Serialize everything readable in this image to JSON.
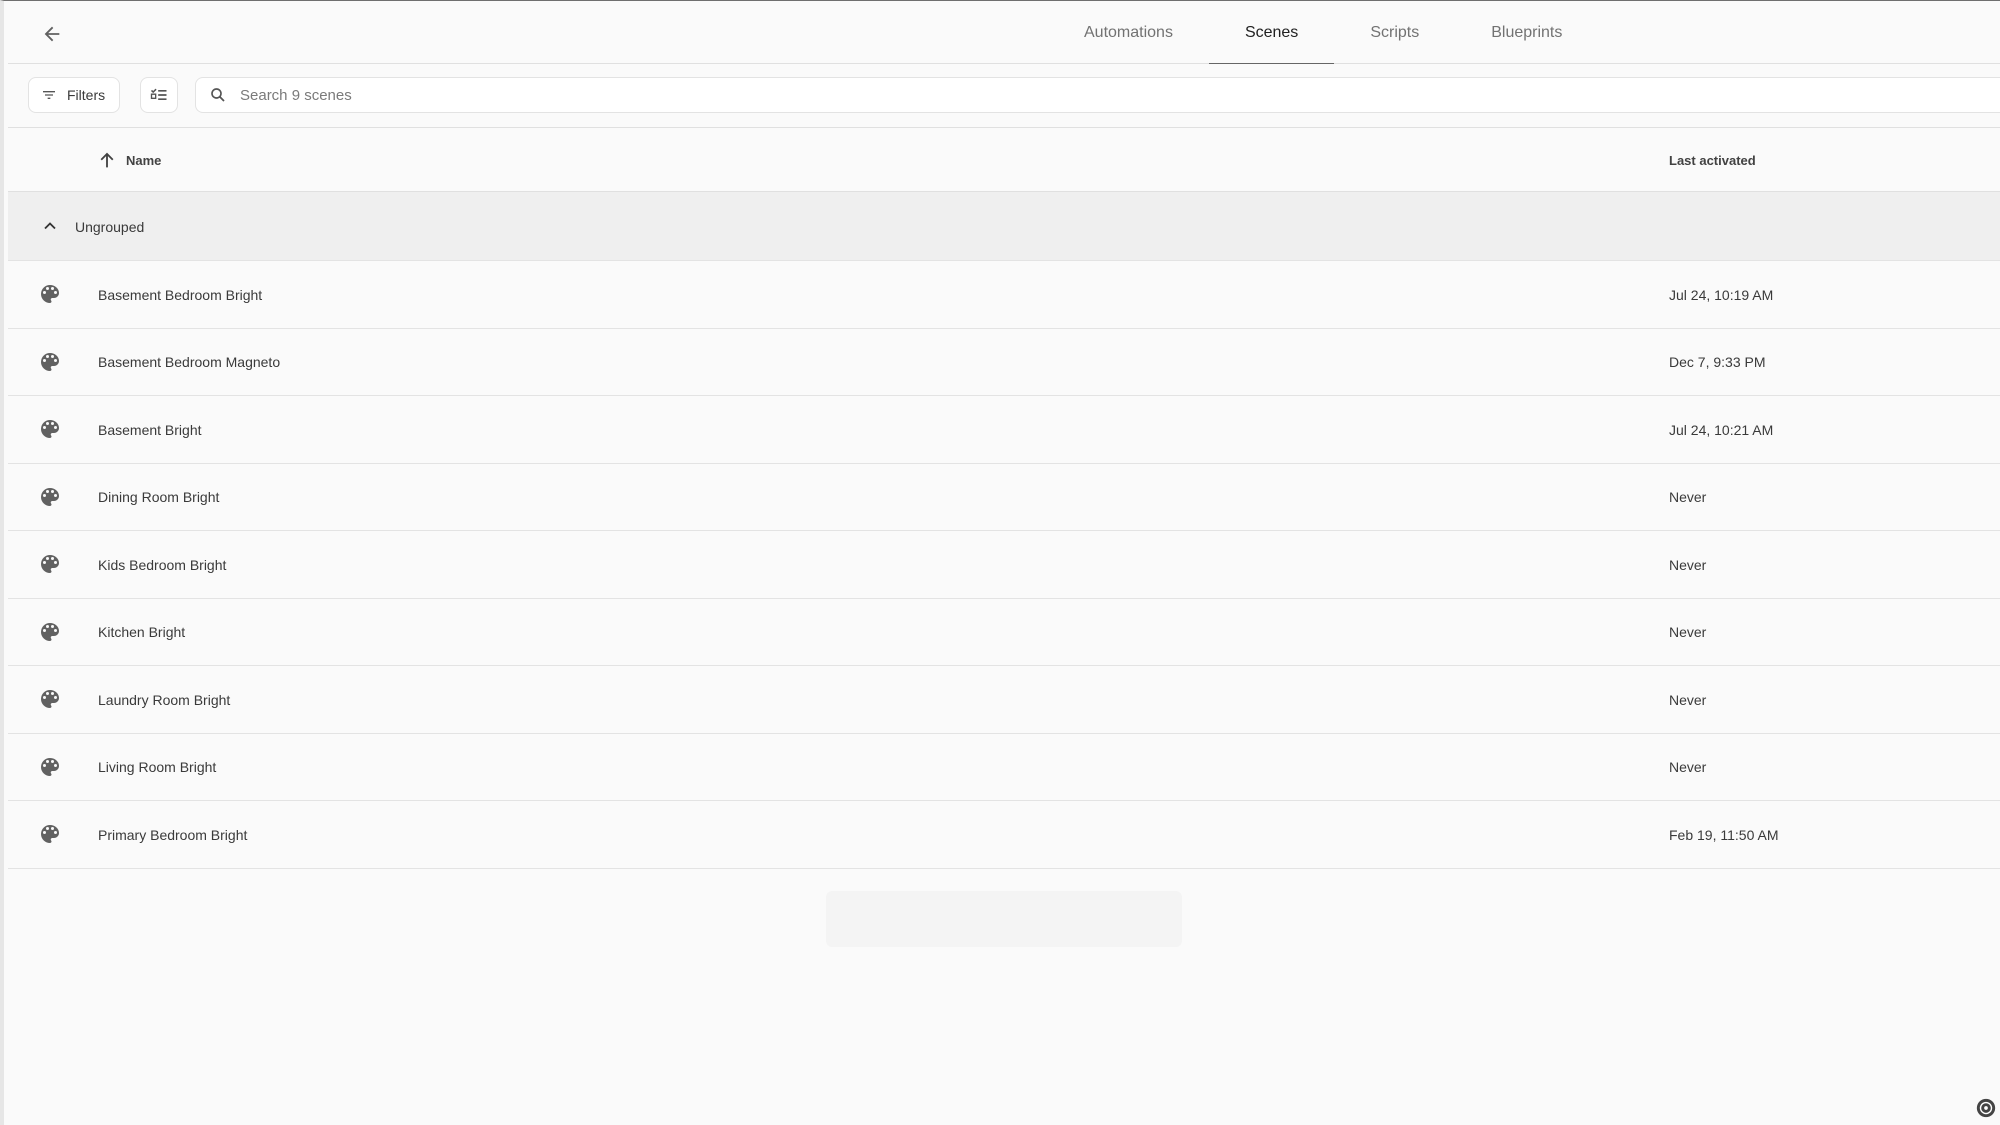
{
  "tabs": [
    {
      "label": "Automations",
      "active": false
    },
    {
      "label": "Scenes",
      "active": true
    },
    {
      "label": "Scripts",
      "active": false
    },
    {
      "label": "Blueprints",
      "active": false
    }
  ],
  "toolbar": {
    "filters_label": "Filters",
    "search_placeholder": "Search 9 scenes",
    "search_value": ""
  },
  "table": {
    "columns": {
      "name": "Name",
      "last_activated": "Last activated"
    },
    "sort": {
      "column": "Name",
      "direction": "ascending"
    },
    "group": {
      "label": "Ungrouped",
      "expanded": true
    },
    "rows": [
      {
        "name": "Basement Bedroom Bright",
        "last_activated": "Jul 24, 10:19 AM"
      },
      {
        "name": "Basement Bedroom Magneto",
        "last_activated": "Dec 7, 9:33 PM"
      },
      {
        "name": "Basement Bright",
        "last_activated": "Jul 24, 10:21 AM"
      },
      {
        "name": "Dining Room Bright",
        "last_activated": "Never"
      },
      {
        "name": "Kids Bedroom Bright",
        "last_activated": "Never"
      },
      {
        "name": "Kitchen Bright",
        "last_activated": "Never"
      },
      {
        "name": "Laundry Room Bright",
        "last_activated": "Never"
      },
      {
        "name": "Living Room Bright",
        "last_activated": "Never"
      },
      {
        "name": "Primary Bedroom Bright",
        "last_activated": "Feb 19, 11:50 AM"
      }
    ]
  },
  "icons": {
    "back": "arrow-left-icon",
    "filters": "filter-icon",
    "select": "selection-list-icon",
    "search": "search-icon",
    "sort": "arrow-up-icon",
    "group": "chevron-up-icon",
    "row": "palette-icon"
  },
  "colors": {
    "background": "#fafafa",
    "group_background": "#efefef",
    "divider": "#e0e0e0",
    "icon": "#616161",
    "active_tab_indicator": "#666666"
  }
}
